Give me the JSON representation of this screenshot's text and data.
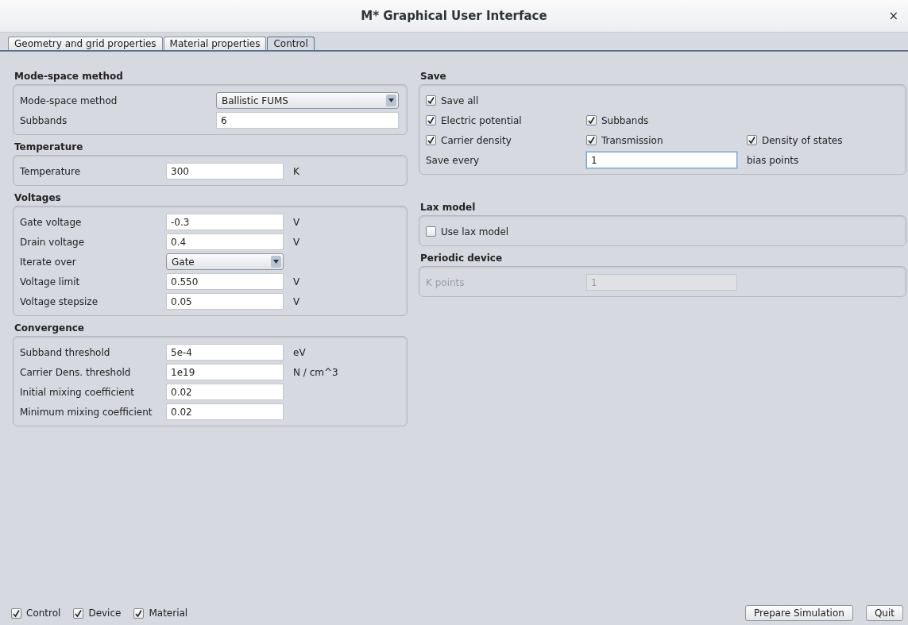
{
  "window": {
    "title": "M* Graphical User Interface",
    "close": "×"
  },
  "tabs": [
    {
      "label": "Geometry and grid properties",
      "selected": false
    },
    {
      "label": "Material properties",
      "selected": false
    },
    {
      "label": "Control",
      "selected": true
    }
  ],
  "left_sections": [
    {
      "title": "Mode-space method",
      "kind": "plain",
      "rows": [
        {
          "kind": "select",
          "label": "Mode-space method",
          "value": "Ballistic FUMS"
        },
        {
          "kind": "text",
          "label": "Subbands",
          "value": "6"
        }
      ]
    },
    {
      "title": "Temperature",
      "kind": "units",
      "rows": [
        {
          "kind": "text",
          "label": "Temperature",
          "value": "300",
          "unit": "K"
        }
      ]
    },
    {
      "title": "Voltages",
      "kind": "units",
      "rows": [
        {
          "kind": "text",
          "label": "Gate voltage",
          "value": "-0.3",
          "unit": "V"
        },
        {
          "kind": "text",
          "label": "Drain voltage",
          "value": "0.4",
          "unit": "V"
        },
        {
          "kind": "select",
          "label": "Iterate over",
          "value": "Gate"
        },
        {
          "kind": "text",
          "label": "Voltage limit",
          "value": "0.550",
          "unit": "V"
        },
        {
          "kind": "text",
          "label": "Voltage stepsize",
          "value": "0.05",
          "unit": "V"
        }
      ]
    },
    {
      "title": "Convergence",
      "kind": "units",
      "rows": [
        {
          "kind": "text",
          "label": "Subband threshold",
          "value": "5e-4",
          "unit": "eV"
        },
        {
          "kind": "text",
          "label": "Carrier Dens. threshold",
          "value": "1e19",
          "unit": "N / cm^3"
        },
        {
          "kind": "text",
          "label": "Initial mixing coefficient",
          "value": "0.02"
        },
        {
          "kind": "text",
          "label": "Minimum mixing coefficient",
          "value": "0.02"
        }
      ]
    }
  ],
  "right_sections": [
    {
      "title": "Save",
      "rows": [
        {
          "kind": "checks",
          "items": [
            {
              "label": "Save all",
              "checked": true
            }
          ]
        },
        {
          "kind": "checks",
          "items": [
            {
              "label": "Electric potential",
              "checked": true
            },
            {
              "label": "Subbands",
              "checked": true
            }
          ]
        },
        {
          "kind": "checks",
          "items": [
            {
              "label": "Carrier density",
              "checked": true
            },
            {
              "label": "Transmission",
              "checked": true
            },
            {
              "label": "Density of states",
              "checked": true
            }
          ]
        },
        {
          "kind": "text",
          "label": "Save every",
          "value": "1",
          "unit": "bias points",
          "focused": true
        }
      ]
    },
    {
      "title": "Lax model",
      "rows": [
        {
          "kind": "checks",
          "items": [
            {
              "label": "Use lax model",
              "checked": false
            }
          ]
        }
      ]
    },
    {
      "title": "Periodic device",
      "rows": [
        {
          "kind": "text",
          "label": "K points",
          "value": "1",
          "disabled": true
        }
      ]
    }
  ],
  "footer": {
    "checks": [
      {
        "label": "Control",
        "checked": true
      },
      {
        "label": "Device",
        "checked": true
      },
      {
        "label": "Material",
        "checked": true
      }
    ],
    "buttons": [
      "Prepare Simulation",
      "Quit"
    ]
  }
}
